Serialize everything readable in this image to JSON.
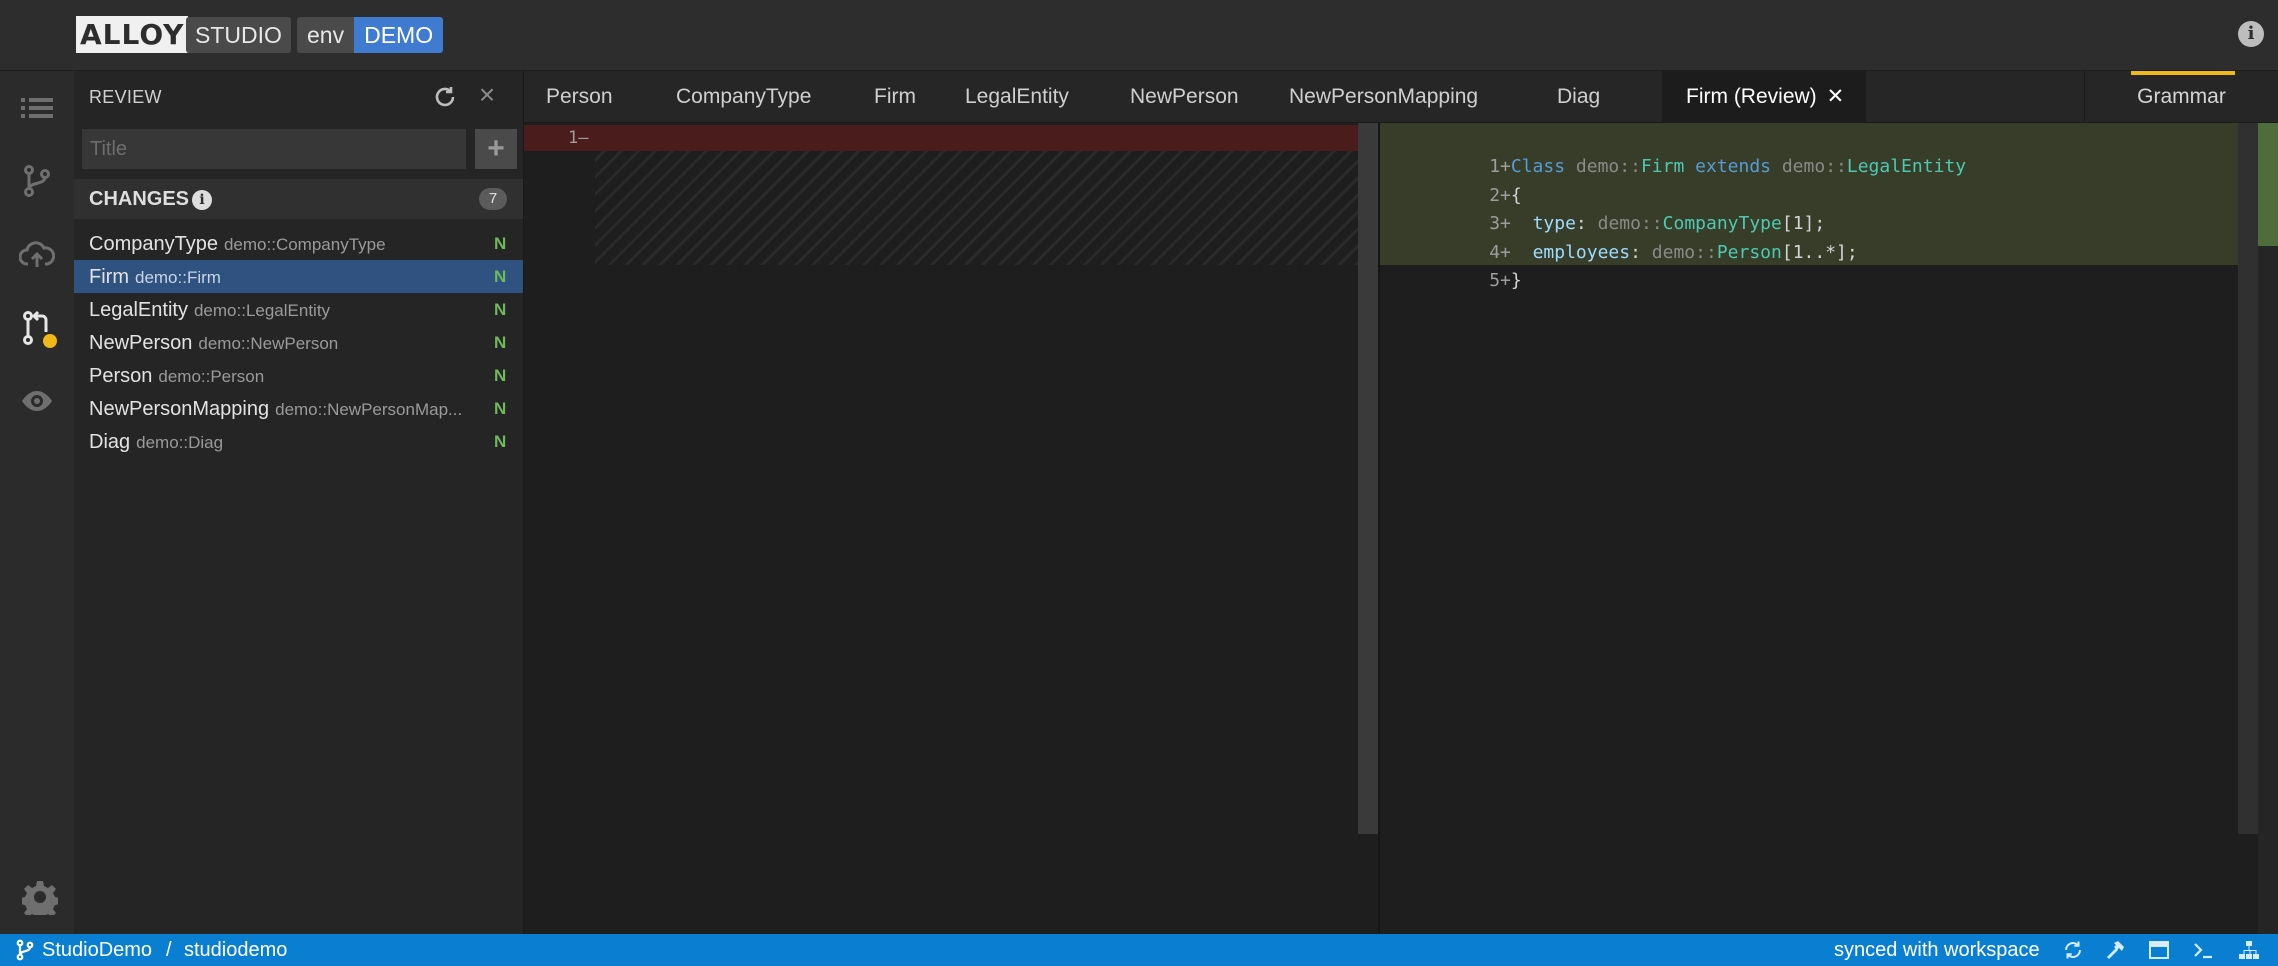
{
  "header": {
    "logo_text": "ALLOY",
    "studio_label": "STUDIO",
    "env_key": "env",
    "env_value": "DEMO",
    "info_icon": "info-circle-icon"
  },
  "activity_bar": {
    "items": [
      {
        "icon": "list-icon",
        "name": "explorer"
      },
      {
        "icon": "git-branch-icon",
        "name": "local-changes"
      },
      {
        "icon": "cloud-upload-icon",
        "name": "workspace-updates"
      },
      {
        "icon": "git-pull-request-icon",
        "name": "review",
        "active": true
      },
      {
        "icon": "eye-icon",
        "name": "project-overview"
      },
      {
        "icon": "gear-icon",
        "name": "settings"
      }
    ]
  },
  "review_panel": {
    "title": "REVIEW",
    "title_placeholder": "Title",
    "add_label": "+",
    "changes_title": "CHANGES",
    "changes_count": "7",
    "changes": [
      {
        "name": "CompanyType",
        "path": "demo::CompanyType",
        "status": "N",
        "selected": false
      },
      {
        "name": "Firm",
        "path": "demo::Firm",
        "status": "N",
        "selected": true
      },
      {
        "name": "LegalEntity",
        "path": "demo::LegalEntity",
        "status": "N",
        "selected": false
      },
      {
        "name": "NewPerson",
        "path": "demo::NewPerson",
        "status": "N",
        "selected": false
      },
      {
        "name": "Person",
        "path": "demo::Person",
        "status": "N",
        "selected": false
      },
      {
        "name": "NewPersonMapping",
        "path": "demo::NewPersonMap...",
        "status": "N",
        "selected": false
      },
      {
        "name": "Diag",
        "path": "demo::Diag",
        "status": "N",
        "selected": false
      }
    ]
  },
  "tabs": {
    "items": [
      "Person",
      "CompanyType",
      "Firm",
      "LegalEntity",
      "NewPerson",
      "NewPersonMapping",
      "Diag",
      "Firm (Review)"
    ],
    "active_close": "✕",
    "grammar_label": "Grammar"
  },
  "diff": {
    "left_line_number": "1",
    "left_marker": "—",
    "right_lines": [
      {
        "n": "1",
        "marker": "+"
      },
      {
        "n": "2",
        "marker": "+"
      },
      {
        "n": "3",
        "marker": "+"
      },
      {
        "n": "4",
        "marker": "+"
      },
      {
        "n": "5",
        "marker": "+"
      }
    ],
    "code": {
      "l1_kw": "Class",
      "l1_ns": "demo::",
      "l1_type": "Firm",
      "l1_ext": "extends",
      "l1_ns2": "demo::",
      "l1_type2": "LegalEntity",
      "l2": "{",
      "l3_prop": "type",
      "l3_colon": ": ",
      "l3_ns": "demo::",
      "l3_type": "CompanyType",
      "l3_mult": "[1];",
      "l4_prop": "employees",
      "l4_colon": ": ",
      "l4_ns": "demo::",
      "l4_type": "Person",
      "l4_mult": "[1..*];",
      "l5": "}"
    }
  },
  "statusbar": {
    "project": "StudioDemo",
    "separator": "/",
    "workspace": "studiodemo",
    "sync_text": "synced with workspace",
    "icons": [
      "sync-icon",
      "hammer-icon",
      "window-icon",
      "terminal-icon",
      "sitemap-icon"
    ]
  }
}
